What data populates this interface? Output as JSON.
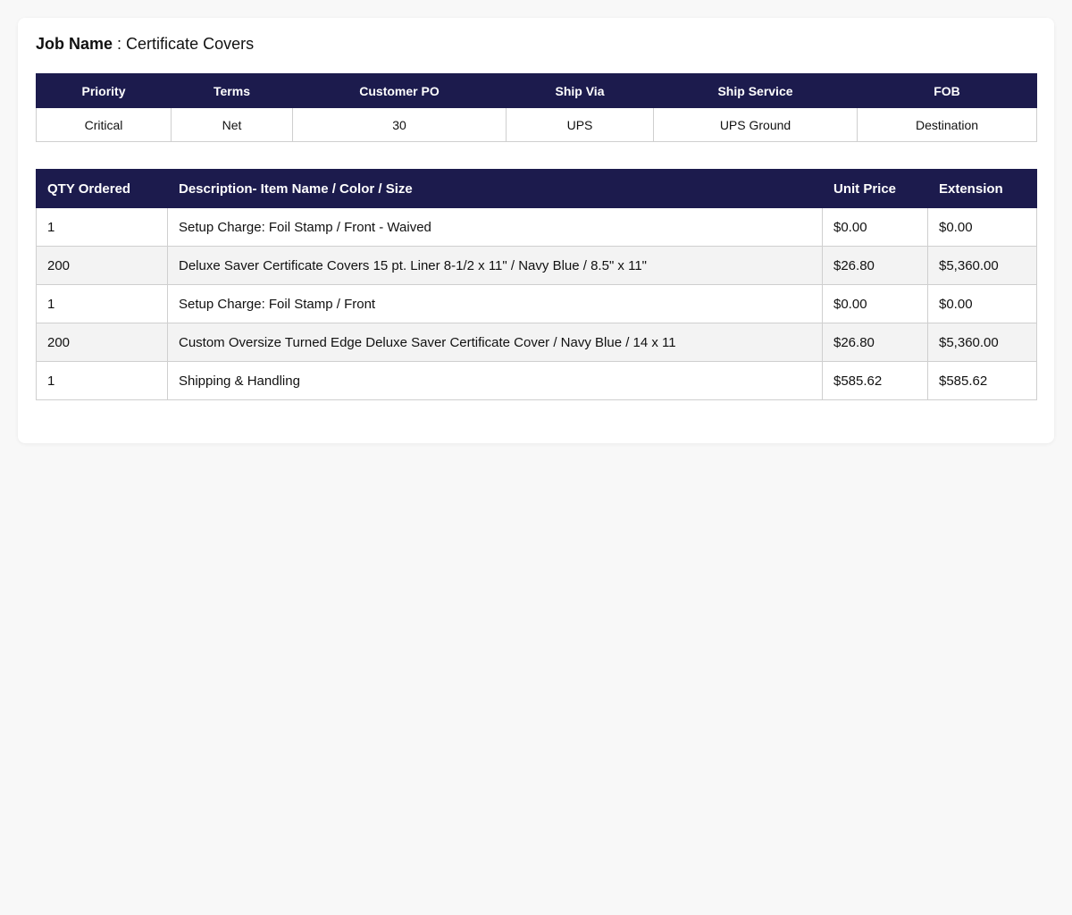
{
  "job": {
    "label": "Job Name",
    "separator": " : ",
    "value": "Certificate Covers"
  },
  "order_meta": {
    "headers": [
      "Priority",
      "Terms",
      "Customer PO",
      "Ship Via",
      "Ship Service",
      "FOB"
    ],
    "values": [
      "Critical",
      "Net",
      "30",
      "UPS",
      "UPS Ground",
      "Destination"
    ]
  },
  "line_items": {
    "headers": [
      "QTY Ordered",
      "Description- Item Name / Color / Size",
      "Unit Price",
      "Extension"
    ],
    "rows": [
      {
        "qty": "1",
        "description": "Setup Charge: Foil Stamp / Front - Waived",
        "unit_price": "$0.00",
        "extension": "$0.00"
      },
      {
        "qty": "200",
        "description": "Deluxe Saver Certificate Covers 15 pt. Liner 8-1/2 x 11\" / Navy Blue / 8.5\" x 11\"",
        "unit_price": "$26.80",
        "extension": "$5,360.00"
      },
      {
        "qty": "1",
        "description": "Setup Charge: Foil Stamp / Front",
        "unit_price": "$0.00",
        "extension": "$0.00"
      },
      {
        "qty": "200",
        "description": "Custom Oversize Turned Edge Deluxe Saver Certificate Cover / Navy Blue / 14 x 11",
        "unit_price": "$26.80",
        "extension": "$5,360.00"
      },
      {
        "qty": "1",
        "description": "Shipping & Handling",
        "unit_price": "$585.62",
        "extension": "$585.62"
      }
    ]
  },
  "colors": {
    "header_bg": "#1c1b4d",
    "header_text": "#ffffff",
    "alt_row_bg": "#f3f3f3",
    "page_bg": "#f8f8f8"
  }
}
